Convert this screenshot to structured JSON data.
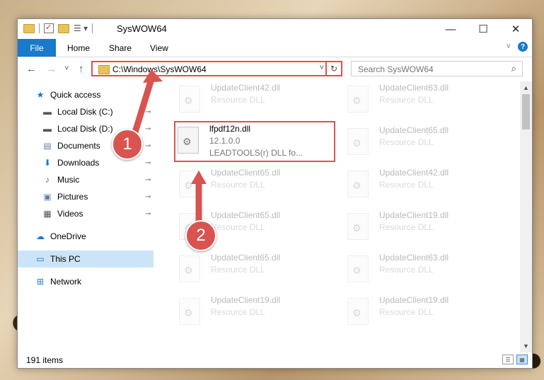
{
  "window": {
    "title": "SysWOW64",
    "controls": {
      "minimize": "—",
      "maximize": "☐",
      "close": "✕"
    }
  },
  "ribbon": {
    "tabs": [
      "File",
      "Home",
      "Share",
      "View"
    ]
  },
  "navigation": {
    "back": "←",
    "forward": "→",
    "recent": "˅",
    "up": "↑",
    "address": "C:\\Windows\\SysWOW64",
    "address_dropdown": "˅",
    "refresh": "↻",
    "search_placeholder": "Search SysWOW64"
  },
  "sidebar": {
    "items": [
      {
        "label": "Quick access",
        "icon": "star-icon",
        "glyph": "★",
        "color": "#1979ca",
        "pinned": false,
        "level": 0
      },
      {
        "label": "Local Disk (C:)",
        "icon": "drive-icon",
        "glyph": "▬",
        "color": "#555",
        "pinned": true,
        "level": 1
      },
      {
        "label": "Local Disk (D:)",
        "icon": "drive-icon",
        "glyph": "▬",
        "color": "#555",
        "pinned": true,
        "level": 1
      },
      {
        "label": "Documents",
        "icon": "documents-icon",
        "glyph": "▤",
        "color": "#5d7fa6",
        "pinned": true,
        "level": 1
      },
      {
        "label": "Downloads",
        "icon": "downloads-icon",
        "glyph": "⬇",
        "color": "#1979ca",
        "pinned": true,
        "level": 1
      },
      {
        "label": "Music",
        "icon": "music-icon",
        "glyph": "♪",
        "color": "#1979ca",
        "pinned": true,
        "level": 1
      },
      {
        "label": "Pictures",
        "icon": "pictures-icon",
        "glyph": "▣",
        "color": "#5d7fa6",
        "pinned": true,
        "level": 1
      },
      {
        "label": "Videos",
        "icon": "videos-icon",
        "glyph": "▦",
        "color": "#555",
        "pinned": true,
        "level": 1
      },
      {
        "label": "OneDrive",
        "icon": "cloud-icon",
        "glyph": "☁",
        "color": "#1979ca",
        "pinned": false,
        "level": 0
      },
      {
        "label": "This PC",
        "icon": "computer-icon",
        "glyph": "▭",
        "color": "#1979ca",
        "pinned": false,
        "level": 0,
        "selected": true
      },
      {
        "label": "Network",
        "icon": "network-icon",
        "glyph": "⊞",
        "color": "#1979ca",
        "pinned": false,
        "level": 0
      }
    ],
    "pin_glyph": "📌"
  },
  "files": {
    "column_left": [
      {
        "name": "UpdateClient42.dll",
        "desc": "Resource DLL",
        "faded": true
      },
      {
        "name": "lfpdf12n.dll",
        "desc": "12.1.0.0",
        "desc2": "LEADTOOLS(r) DLL fo...",
        "faded": false,
        "highlight": true
      },
      {
        "name": "UpdateClient65.dll",
        "desc": "Resource DLL",
        "faded": true
      },
      {
        "name": "UpdateClient65.dll",
        "desc": "Resource DLL",
        "faded": true
      },
      {
        "name": "UpdateClient65.dll",
        "desc": "Resource DLL",
        "faded": true
      },
      {
        "name": "UpdateClient19.dll",
        "desc": "Resource DLL",
        "faded": true
      }
    ],
    "column_right": [
      {
        "name": "UpdateClient63.dll",
        "desc": "Resource DLL",
        "faded": true
      },
      {
        "name": "UpdateClient65.dll",
        "desc": "Resource DLL",
        "faded": true
      },
      {
        "name": "UpdateClient42.dll",
        "desc": "Resource DLL",
        "faded": true
      },
      {
        "name": "UpdateClient19.dll",
        "desc": "Resource DLL",
        "faded": true
      },
      {
        "name": "UpdateClient63.dll",
        "desc": "Resource DLL",
        "faded": true
      },
      {
        "name": "UpdateClient19.dll",
        "desc": "Resource DLL",
        "faded": true
      }
    ]
  },
  "status": {
    "item_count": "191 items"
  },
  "callouts": [
    "1",
    "2"
  ],
  "colors": {
    "accent": "#1979ca",
    "highlight_red": "#d9534f",
    "selected_bg": "#cce4f7"
  }
}
